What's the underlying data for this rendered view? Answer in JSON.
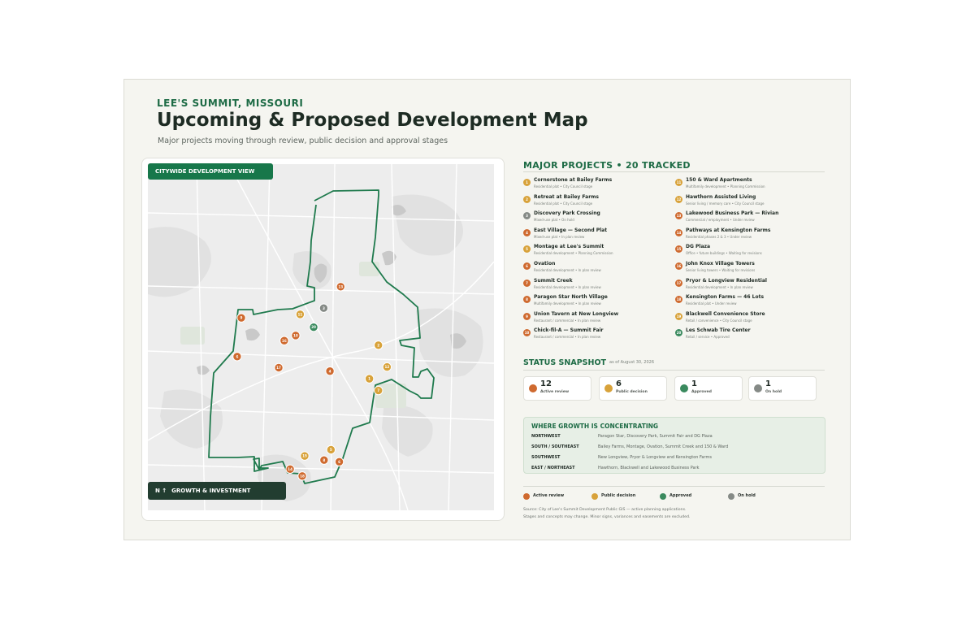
{
  "header": {
    "kicker": "LEE'S SUMMIT, MISSOURI",
    "title": "Upcoming & Proposed Development Map",
    "subtitle": "Major projects moving through review, public decision and approval stages"
  },
  "map": {
    "top_tag": "CITYWIDE DEVELOPMENT VIEW",
    "bottom_tag_arrow": "N  ↑",
    "bottom_tag": "GROWTH & INVESTMENT",
    "boundary_color": "#1f7a4d",
    "markers": [
      {
        "n": "1",
        "status": "public",
        "x": 0.64,
        "y": 0.62
      },
      {
        "n": "2",
        "status": "public",
        "x": 0.666,
        "y": 0.523
      },
      {
        "n": "3",
        "status": "hold",
        "x": 0.508,
        "y": 0.416
      },
      {
        "n": "4",
        "status": "active",
        "x": 0.526,
        "y": 0.598
      },
      {
        "n": "5",
        "status": "public",
        "x": 0.529,
        "y": 0.825
      },
      {
        "n": "6",
        "status": "active",
        "x": 0.553,
        "y": 0.86
      },
      {
        "n": "6",
        "status": "active",
        "x": 0.258,
        "y": 0.556
      },
      {
        "n": "7",
        "status": "public",
        "x": 0.666,
        "y": 0.654
      },
      {
        "n": "8",
        "status": "active",
        "x": 0.509,
        "y": 0.855
      },
      {
        "n": "9",
        "status": "active",
        "x": 0.27,
        "y": 0.444
      },
      {
        "n": "10",
        "status": "active",
        "x": 0.427,
        "y": 0.495
      },
      {
        "n": "11",
        "status": "public",
        "x": 0.44,
        "y": 0.434
      },
      {
        "n": "12",
        "status": "public",
        "x": 0.691,
        "y": 0.586
      },
      {
        "n": "13",
        "status": "active",
        "x": 0.557,
        "y": 0.354
      },
      {
        "n": "14",
        "status": "active",
        "x": 0.411,
        "y": 0.881
      },
      {
        "n": "15",
        "status": "public",
        "x": 0.453,
        "y": 0.843
      },
      {
        "n": "16",
        "status": "active",
        "x": 0.394,
        "y": 0.51
      },
      {
        "n": "17",
        "status": "active",
        "x": 0.378,
        "y": 0.588
      },
      {
        "n": "18",
        "status": "active",
        "x": 0.446,
        "y": 0.901
      },
      {
        "n": "20",
        "status": "approved",
        "x": 0.479,
        "y": 0.471
      }
    ]
  },
  "projects": {
    "heading": "MAJOR PROJECTS  •  20 TRACKED",
    "items": [
      {
        "n": "1",
        "name": "Cornerstone at Bailey Farms",
        "meta": "Residential plat  •  City Council stage",
        "status": "public"
      },
      {
        "n": "2",
        "name": "Retreat at Bailey Farms",
        "meta": "Residential plat  •  City Council stage",
        "status": "public"
      },
      {
        "n": "3",
        "name": "Discovery Park Crossing",
        "meta": "Mixed-use plat  •  On hold",
        "status": "hold"
      },
      {
        "n": "4",
        "name": "East Village — Second Plat",
        "meta": "Mixed-use plat  •  In plan review",
        "status": "active"
      },
      {
        "n": "5",
        "name": "Montage at Lee's Summit",
        "meta": "Residential development  •  Planning Commission",
        "status": "public"
      },
      {
        "n": "6",
        "name": "Ovation",
        "meta": "Residential development  •  In plan review",
        "status": "active"
      },
      {
        "n": "7",
        "name": "Summit Creek",
        "meta": "Residential development  •  In plan review",
        "status": "active"
      },
      {
        "n": "8",
        "name": "Paragon Star North Village",
        "meta": "Multifamily development  •  In plan review",
        "status": "active"
      },
      {
        "n": "9",
        "name": "Union Tavern at New Longview",
        "meta": "Restaurant / commercial  •  In plan review",
        "status": "active"
      },
      {
        "n": "10",
        "name": "Chick-fil-A — Summit Fair",
        "meta": "Restaurant / commercial  •  In plan review",
        "status": "active"
      },
      {
        "n": "11",
        "name": "150 & Ward Apartments",
        "meta": "Multifamily development  •  Planning Commission",
        "status": "public"
      },
      {
        "n": "12",
        "name": "Hawthorn Assisted Living",
        "meta": "Senior living / memory care  •  City Council stage",
        "status": "public"
      },
      {
        "n": "13",
        "name": "Lakewood Business Park — Rivian",
        "meta": "Commercial / employment  •  Under review",
        "status": "active"
      },
      {
        "n": "14",
        "name": "Pathways at Kensington Farms",
        "meta": "Residential phases 2 & 3  •  Under review",
        "status": "active"
      },
      {
        "n": "15",
        "name": "DG Plaza",
        "meta": "Office  •  future buildings  •  Waiting for revisions",
        "status": "active"
      },
      {
        "n": "16",
        "name": "John Knox Village Towers",
        "meta": "Senior living towers  •  Waiting for revisions",
        "status": "active"
      },
      {
        "n": "17",
        "name": "Pryor & Longview Residential",
        "meta": "Residential development  •  In plan review",
        "status": "active"
      },
      {
        "n": "18",
        "name": "Kensington Farms — 46 Lots",
        "meta": "Residential plat  •  Under review",
        "status": "active"
      },
      {
        "n": "19",
        "name": "Blackwell Convenience Store",
        "meta": "Retail / convenience  •  City Council stage",
        "status": "public"
      },
      {
        "n": "20",
        "name": "Les Schwab Tire Center",
        "meta": "Retail / service  •  Approved",
        "status": "approved"
      }
    ]
  },
  "snapshot": {
    "heading": "STATUS SNAPSHOT",
    "date": "as of August 30, 2026",
    "stats": [
      {
        "value": "12",
        "label": "Active review",
        "status": "active"
      },
      {
        "value": "6",
        "label": "Public decision",
        "status": "public"
      },
      {
        "value": "1",
        "label": "Approved",
        "status": "approved"
      },
      {
        "value": "1",
        "label": "On hold",
        "status": "hold"
      }
    ]
  },
  "growth": {
    "heading": "WHERE GROWTH IS CONCENTRATING",
    "rows": [
      {
        "region": "NORTHWEST",
        "projects": "Paragon Star, Discovery Park, Summit Fair and DG Plaza"
      },
      {
        "region": "SOUTH / SOUTHEAST",
        "projects": "Bailey Farms, Montage, Ovation, Summit Creek and 150 & Ward"
      },
      {
        "region": "SOUTHWEST",
        "projects": "New Longview, Pryor & Longview and Kensington Farms"
      },
      {
        "region": "EAST / NORTHEAST",
        "projects": "Hawthorn, Blackwell and Lakewood Business Park"
      }
    ]
  },
  "legend": [
    {
      "label": "Active review",
      "status": "active"
    },
    {
      "label": "Public decision",
      "status": "public"
    },
    {
      "label": "Approved",
      "status": "approved"
    },
    {
      "label": "On hold",
      "status": "hold"
    }
  ],
  "source": {
    "line1": "Source: City of Lee's Summit Development Public GIS — active planning applications.",
    "line2": "Stages and concepts may change. Minor signs, variances and easements are excluded."
  },
  "colors": {
    "active": "#cf6a2f",
    "public": "#d8a23a",
    "approved": "#3a8a5e",
    "hold": "#858a86",
    "accent": "#1d6b45"
  }
}
